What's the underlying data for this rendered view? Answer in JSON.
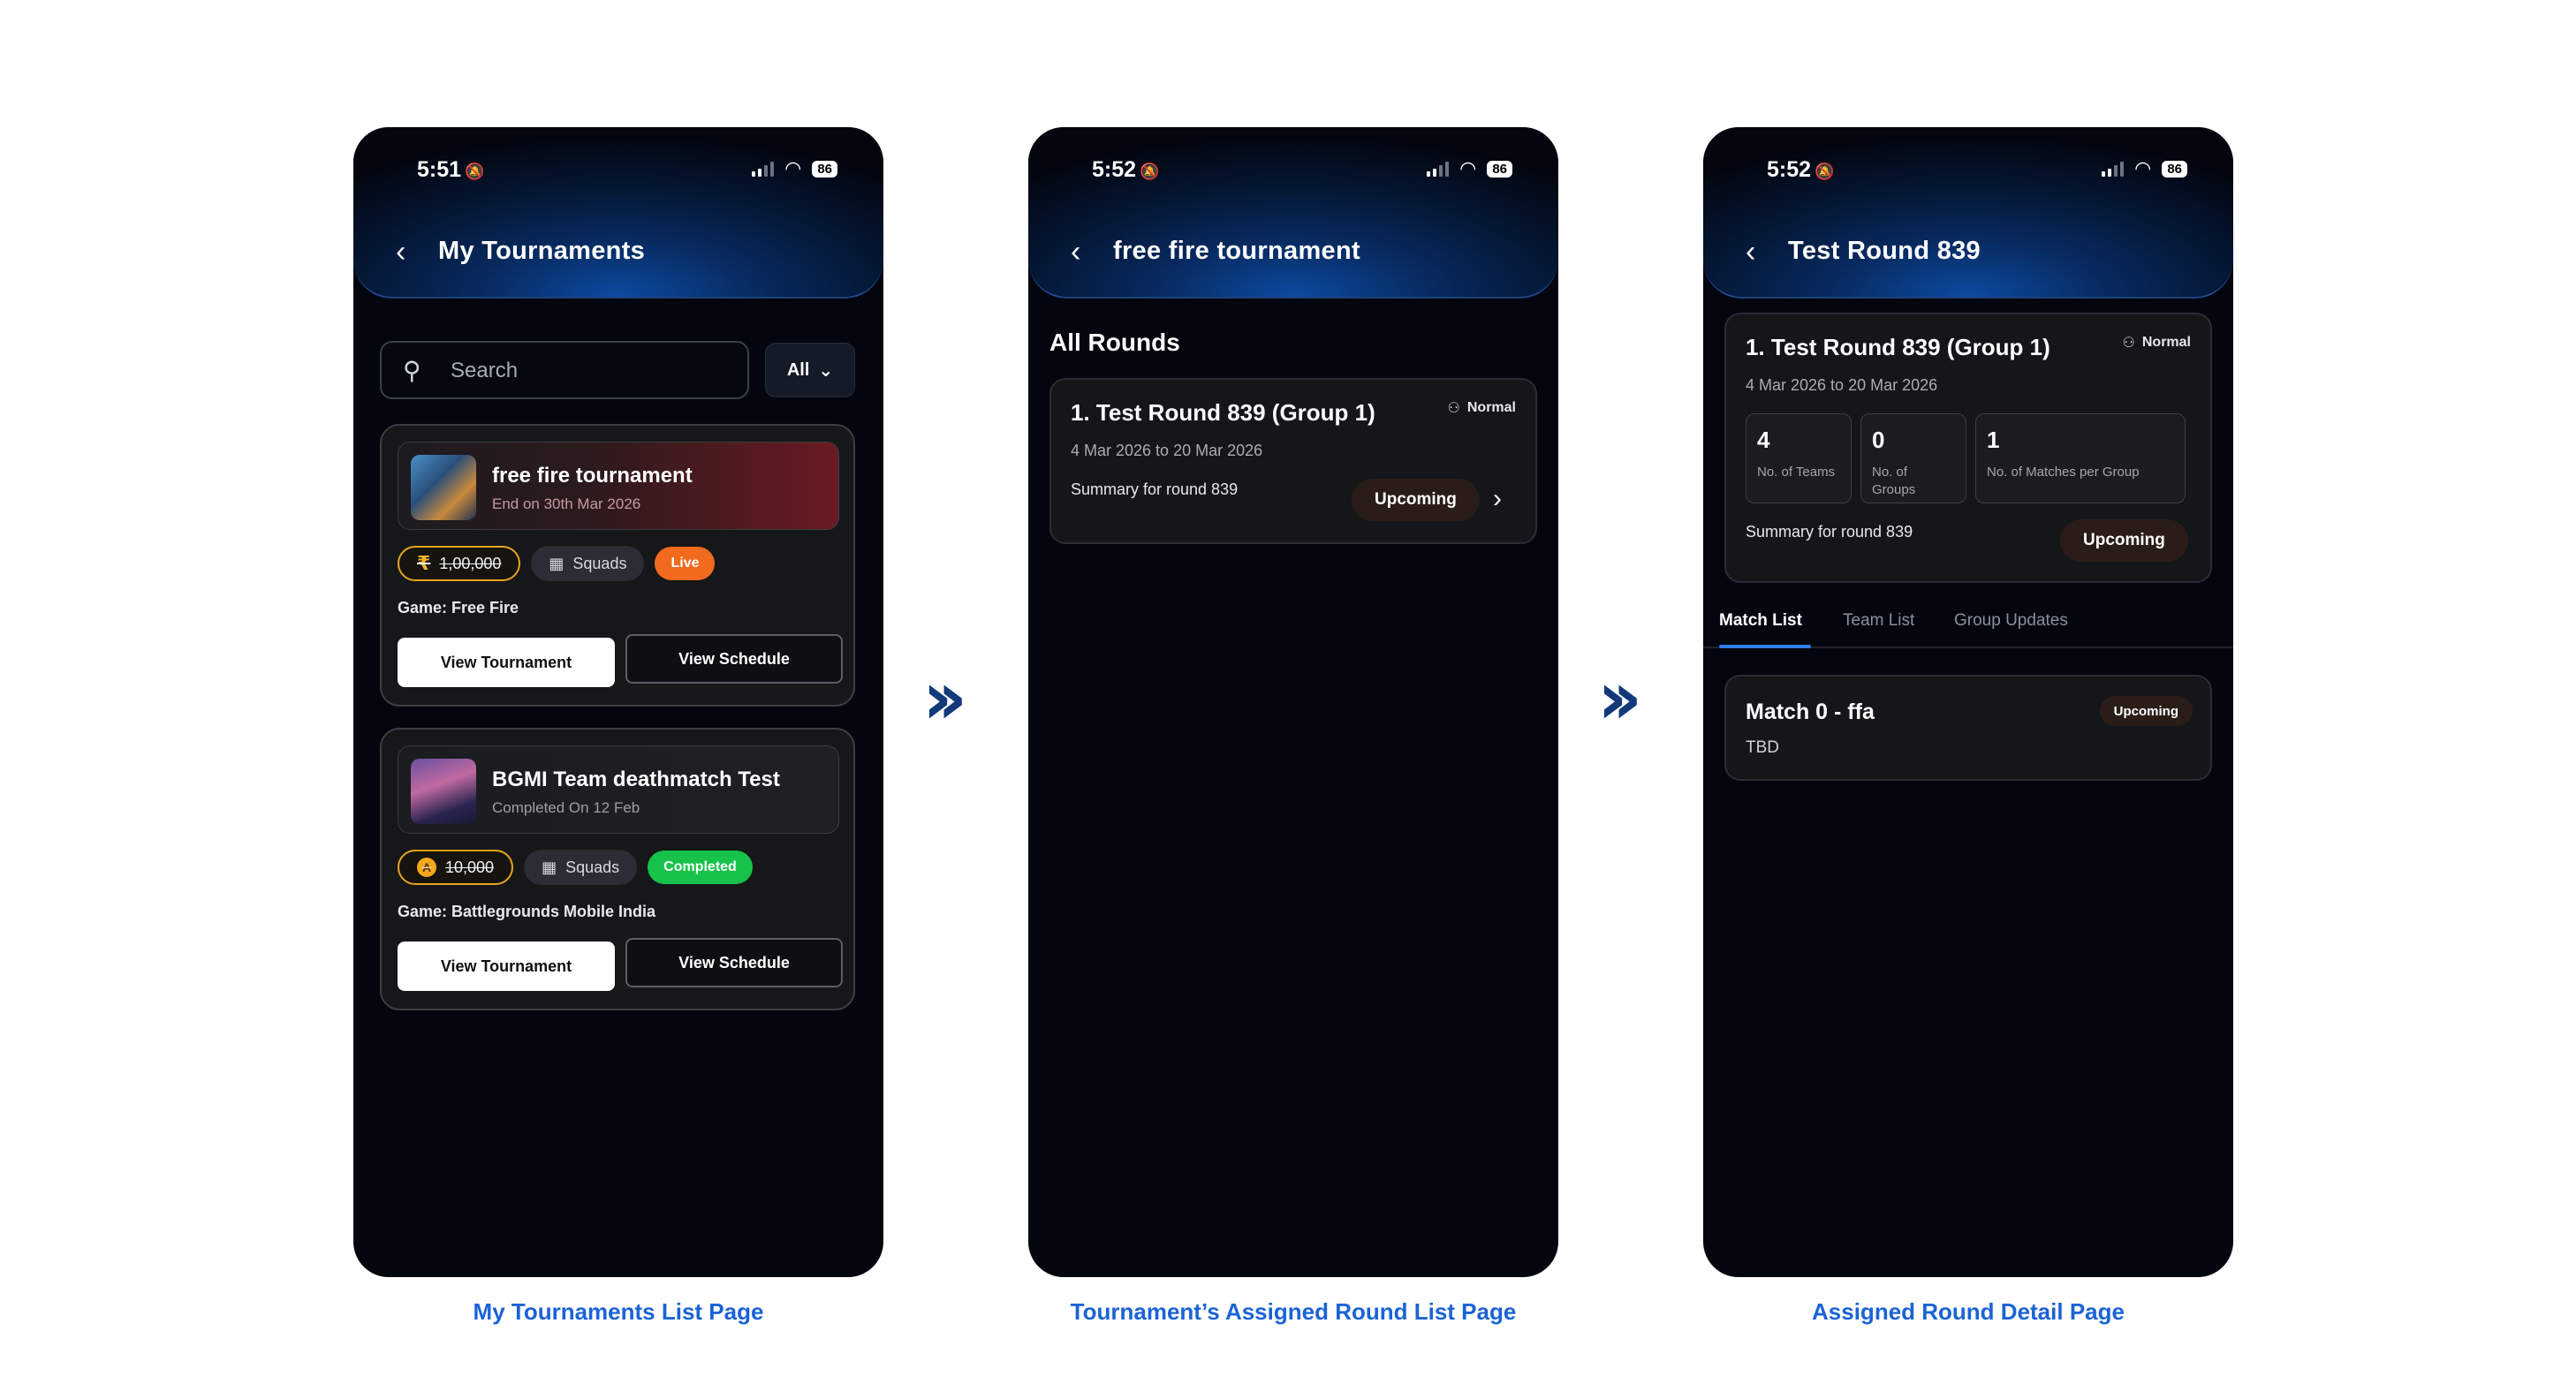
{
  "screens": [
    {
      "time": "5:51",
      "battery": "86",
      "title": "My Tournaments",
      "search_placeholder": "Search",
      "filter_label": "All",
      "tournaments": [
        {
          "name": "free fire tournament",
          "subtitle": "End on 30th Mar 2026",
          "prize": "1,00,000",
          "mode": "Squads",
          "status": "Live",
          "game": "Game: Free Fire",
          "view_tournament": "View Tournament",
          "view_schedule": "View Schedule"
        },
        {
          "name": "BGMI Team deathmatch Test",
          "subtitle": "Completed On 12 Feb",
          "prize": "10,000",
          "mode": "Squads",
          "status": "Completed",
          "game": "Game: Battlegrounds Mobile India",
          "view_tournament": "View Tournament",
          "view_schedule": "View Schedule"
        }
      ]
    },
    {
      "time": "5:52",
      "battery": "86",
      "title": "free fire tournament",
      "section_title": "All Rounds",
      "round": {
        "name": "1. Test Round 839 (Group 1)",
        "type": "Normal",
        "dates": "4 Mar 2026 to 20 Mar 2026",
        "summary": "Summary for round 839",
        "status": "Upcoming"
      }
    },
    {
      "time": "5:52",
      "battery": "86",
      "title": "Test Round 839",
      "round": {
        "name": "1. Test Round 839 (Group 1)",
        "type": "Normal",
        "dates": "4 Mar 2026 to 20 Mar 2026",
        "summary": "Summary for round 839",
        "status": "Upcoming"
      },
      "stats": [
        {
          "value": "4",
          "label": "No. of Teams"
        },
        {
          "value": "0",
          "label": "No. of Groups"
        },
        {
          "value": "1",
          "label": "No. of Matches per Group"
        }
      ],
      "tabs": [
        "Match List",
        "Team List",
        "Group Updates"
      ],
      "match": {
        "name": "Match 0 - ffa",
        "sub": "TBD",
        "status": "Upcoming"
      }
    }
  ],
  "captions": [
    "My Tournaments List Page",
    "Tournament’s Assigned Round List Page",
    "Assigned Round Detail  Page"
  ],
  "icons": [
    "bell-off-icon",
    "signal-icon",
    "wifi-icon",
    "battery-icon",
    "back-icon",
    "search-icon",
    "chevron-down-icon",
    "rupee-icon",
    "coin-icon",
    "map-icon",
    "users-icon",
    "chevron-right-icon",
    "double-chevron-icon"
  ],
  "colors": {
    "accent_blue": "#1b63d6",
    "arrow": "#123a7a",
    "live": "#f26a1d",
    "completed": "#17c24a",
    "prize_border": "#e8a41a",
    "tab_underline": "#2f7ce8",
    "screen_bg": "#03060f"
  }
}
